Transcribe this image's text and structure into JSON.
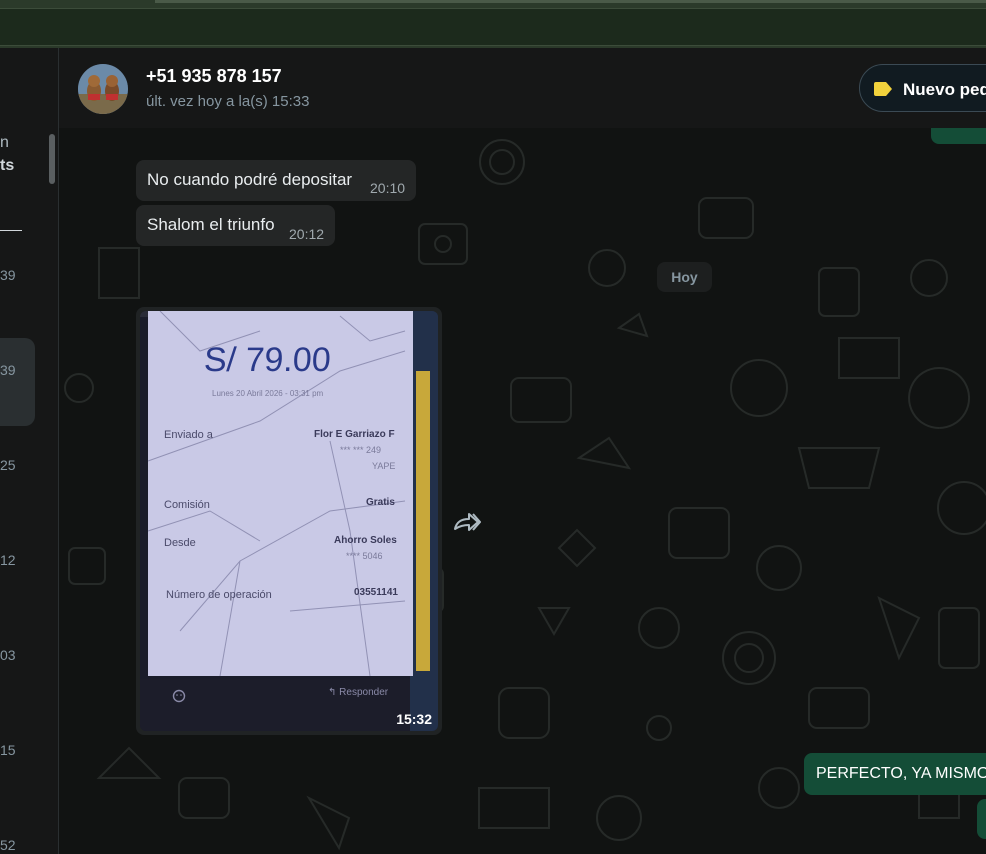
{
  "contact": {
    "name": "+51 935 878 157",
    "status": "últ. vez hoy a la(s) 15:33"
  },
  "header_action": {
    "label": "Nuevo ped",
    "tag_color": "#f2d23c"
  },
  "sidebar_cut": {
    "texts": [
      "n",
      "ts"
    ],
    "times": [
      "39",
      "39",
      "25",
      "12",
      "03",
      "15",
      "52"
    ]
  },
  "messages": [
    {
      "text": "No cuando podré depositar",
      "time": "20:10"
    },
    {
      "text": "Shalom el triunfo",
      "time": "20:12"
    }
  ],
  "day_separator": "Hoy",
  "image_message": {
    "time": "15:32",
    "receipt": {
      "amount": "S/ 79.00",
      "date": "Lunes 20 Abril 2026 - 03:31 pm",
      "sent_to_label": "Enviado a",
      "sent_to_name": "Flor E Garriazo F",
      "sent_to_number": "*** *** 249",
      "sent_to_app": "YAPE",
      "fee_label": "Comisión",
      "fee_value": "Gratis",
      "from_label": "Desde",
      "from_account": "Ahorro Soles",
      "from_number": "**** 5046",
      "operation_label": "Número de operación",
      "operation_value": "03551141",
      "reply_label": "Responder"
    }
  },
  "outgoing": [
    {
      "text": "PERFECTO, YA MISMO"
    }
  ],
  "colors": {
    "outgoing_bubble": "#144d37",
    "incoming_bubble": "#242626",
    "background": "#111312"
  }
}
